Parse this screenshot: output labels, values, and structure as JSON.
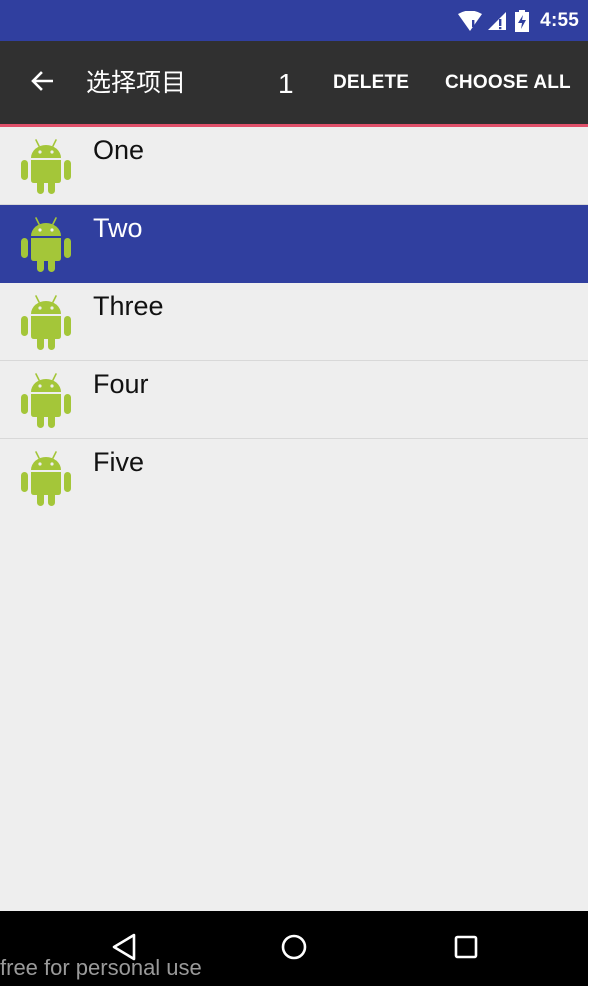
{
  "status_bar": {
    "time": "4:55",
    "icons": [
      "wifi-icon",
      "signal-icon",
      "battery-icon"
    ],
    "background": "#303f9f"
  },
  "action_mode": {
    "title": "选择项目",
    "selected_count": "1",
    "delete_label": "DELETE",
    "choose_all_label": "CHOOSE ALL",
    "background": "#303030",
    "accent_line": "#e0506a"
  },
  "list": {
    "items": [
      {
        "label": "One",
        "icon": "android-icon",
        "selected": false
      },
      {
        "label": "Two",
        "icon": "android-icon",
        "selected": true
      },
      {
        "label": "Three",
        "icon": "android-icon",
        "selected": false
      },
      {
        "label": "Four",
        "icon": "android-icon",
        "selected": false
      },
      {
        "label": "Five",
        "icon": "android-icon",
        "selected": false
      }
    ],
    "selected_color": "#303f9f",
    "icon_color": "#a4c639"
  },
  "nav_bar": {
    "buttons": [
      "back-triangle-icon",
      "home-circle-icon",
      "recent-square-icon"
    ]
  },
  "watermark": {
    "text": "free for personal use"
  }
}
